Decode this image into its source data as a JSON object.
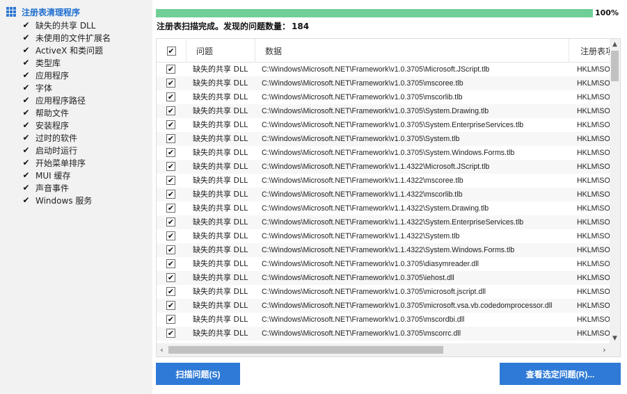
{
  "sidebar": {
    "title": "注册表清理程序",
    "items": [
      {
        "label": "缺失的共享 DLL",
        "checked": true
      },
      {
        "label": "未使用的文件扩展名",
        "checked": true
      },
      {
        "label": "ActiveX 和类问题",
        "checked": true
      },
      {
        "label": "类型库",
        "checked": true
      },
      {
        "label": "应用程序",
        "checked": true
      },
      {
        "label": "字体",
        "checked": true
      },
      {
        "label": "应用程序路径",
        "checked": true
      },
      {
        "label": "帮助文件",
        "checked": true
      },
      {
        "label": "安装程序",
        "checked": true
      },
      {
        "label": "过时的软件",
        "checked": true
      },
      {
        "label": "启动时运行",
        "checked": true
      },
      {
        "label": "开始菜单排序",
        "checked": true
      },
      {
        "label": "MUI 缓存",
        "checked": true
      },
      {
        "label": "声音事件",
        "checked": true
      },
      {
        "label": "Windows 服务",
        "checked": true
      }
    ]
  },
  "progress": {
    "percent_label": "100%",
    "percent": 100,
    "color": "#6fcf97"
  },
  "status": {
    "text": "注册表扫描完成。发现的问题数量：",
    "count": "184"
  },
  "table": {
    "headers": {
      "problem": "问题",
      "data": "数据",
      "key": "注册表项"
    },
    "header_checked": true,
    "rows": [
      {
        "checked": true,
        "problem": "缺失的共享 DLL",
        "data": "C:\\Windows\\Microsoft.NET\\Framework\\v1.0.3705\\Microsoft.JScript.tlb",
        "key": "HKLM\\SO"
      },
      {
        "checked": true,
        "problem": "缺失的共享 DLL",
        "data": "C:\\Windows\\Microsoft.NET\\Framework\\v1.0.3705\\mscoree.tlb",
        "key": "HKLM\\SO"
      },
      {
        "checked": true,
        "problem": "缺失的共享 DLL",
        "data": "C:\\Windows\\Microsoft.NET\\Framework\\v1.0.3705\\mscorlib.tlb",
        "key": "HKLM\\SO"
      },
      {
        "checked": true,
        "problem": "缺失的共享 DLL",
        "data": "C:\\Windows\\Microsoft.NET\\Framework\\v1.0.3705\\System.Drawing.tlb",
        "key": "HKLM\\SO"
      },
      {
        "checked": true,
        "problem": "缺失的共享 DLL",
        "data": "C:\\Windows\\Microsoft.NET\\Framework\\v1.0.3705\\System.EnterpriseServices.tlb",
        "key": "HKLM\\SO"
      },
      {
        "checked": true,
        "problem": "缺失的共享 DLL",
        "data": "C:\\Windows\\Microsoft.NET\\Framework\\v1.0.3705\\System.tlb",
        "key": "HKLM\\SO"
      },
      {
        "checked": true,
        "problem": "缺失的共享 DLL",
        "data": "C:\\Windows\\Microsoft.NET\\Framework\\v1.0.3705\\System.Windows.Forms.tlb",
        "key": "HKLM\\SO"
      },
      {
        "checked": true,
        "problem": "缺失的共享 DLL",
        "data": "C:\\Windows\\Microsoft.NET\\Framework\\v1.1.4322\\Microsoft.JScript.tlb",
        "key": "HKLM\\SO"
      },
      {
        "checked": true,
        "problem": "缺失的共享 DLL",
        "data": "C:\\Windows\\Microsoft.NET\\Framework\\v1.1.4322\\mscoree.tlb",
        "key": "HKLM\\SO"
      },
      {
        "checked": true,
        "problem": "缺失的共享 DLL",
        "data": "C:\\Windows\\Microsoft.NET\\Framework\\v1.1.4322\\mscorlib.tlb",
        "key": "HKLM\\SO"
      },
      {
        "checked": true,
        "problem": "缺失的共享 DLL",
        "data": "C:\\Windows\\Microsoft.NET\\Framework\\v1.1.4322\\System.Drawing.tlb",
        "key": "HKLM\\SO"
      },
      {
        "checked": true,
        "problem": "缺失的共享 DLL",
        "data": "C:\\Windows\\Microsoft.NET\\Framework\\v1.1.4322\\System.EnterpriseServices.tlb",
        "key": "HKLM\\SO"
      },
      {
        "checked": true,
        "problem": "缺失的共享 DLL",
        "data": "C:\\Windows\\Microsoft.NET\\Framework\\v1.1.4322\\System.tlb",
        "key": "HKLM\\SO"
      },
      {
        "checked": true,
        "problem": "缺失的共享 DLL",
        "data": "C:\\Windows\\Microsoft.NET\\Framework\\v1.1.4322\\System.Windows.Forms.tlb",
        "key": "HKLM\\SO"
      },
      {
        "checked": true,
        "problem": "缺失的共享 DLL",
        "data": "C:\\Windows\\Microsoft.NET\\Framework\\v1.0.3705\\diasymreader.dll",
        "key": "HKLM\\SO"
      },
      {
        "checked": true,
        "problem": "缺失的共享 DLL",
        "data": "C:\\Windows\\Microsoft.NET\\Framework\\v1.0.3705\\iehost.dll",
        "key": "HKLM\\SO"
      },
      {
        "checked": true,
        "problem": "缺失的共享 DLL",
        "data": "C:\\Windows\\Microsoft.NET\\Framework\\v1.0.3705\\microsoft.jscript.dll",
        "key": "HKLM\\SO"
      },
      {
        "checked": true,
        "problem": "缺失的共享 DLL",
        "data": "C:\\Windows\\Microsoft.NET\\Framework\\v1.0.3705\\microsoft.vsa.vb.codedomprocessor.dll",
        "key": "HKLM\\SO"
      },
      {
        "checked": true,
        "problem": "缺失的共享 DLL",
        "data": "C:\\Windows\\Microsoft.NET\\Framework\\v1.0.3705\\mscordbi.dll",
        "key": "HKLM\\SO"
      },
      {
        "checked": true,
        "problem": "缺失的共享 DLL",
        "data": "C:\\Windows\\Microsoft.NET\\Framework\\v1.0.3705\\mscorrc.dll",
        "key": "HKLM\\SO"
      }
    ]
  },
  "buttons": {
    "scan": "扫描问题(S)",
    "view": "查看选定问题(R)..."
  },
  "colors": {
    "accent": "#2f7ad6",
    "title": "#1f6fd0",
    "progress": "#6fcf97"
  },
  "icons": {
    "sidebar_title": "grid-icon",
    "checkbox": "check-icon"
  }
}
